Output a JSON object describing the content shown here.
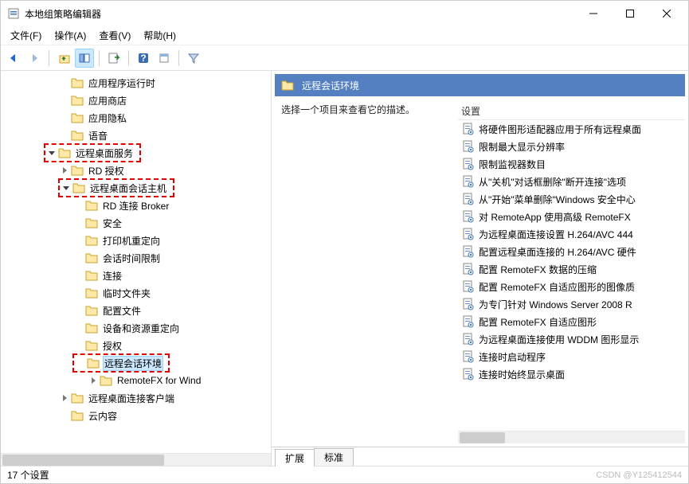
{
  "window": {
    "title": "本地组策略编辑器"
  },
  "menu": {
    "file": "文件(F)",
    "action": "操作(A)",
    "view": "查看(V)",
    "help": "帮助(H)"
  },
  "tree": {
    "items": [
      {
        "indent": 4,
        "exp": "none",
        "label": "应用程序运行时"
      },
      {
        "indent": 4,
        "exp": "none",
        "label": "应用商店"
      },
      {
        "indent": 4,
        "exp": "none",
        "label": "应用隐私"
      },
      {
        "indent": 4,
        "exp": "none",
        "label": "语音"
      },
      {
        "indent": 3,
        "exp": "open",
        "label": "远程桌面服务",
        "hl": true
      },
      {
        "indent": 4,
        "exp": "closed",
        "label": "RD 授权"
      },
      {
        "indent": 4,
        "exp": "open",
        "label": "远程桌面会话主机",
        "hl": true
      },
      {
        "indent": 5,
        "exp": "none",
        "label": "RD 连接 Broker"
      },
      {
        "indent": 5,
        "exp": "none",
        "label": "安全"
      },
      {
        "indent": 5,
        "exp": "none",
        "label": "打印机重定向"
      },
      {
        "indent": 5,
        "exp": "none",
        "label": "会话时间限制"
      },
      {
        "indent": 5,
        "exp": "none",
        "label": "连接"
      },
      {
        "indent": 5,
        "exp": "none",
        "label": "临时文件夹"
      },
      {
        "indent": 5,
        "exp": "none",
        "label": "配置文件"
      },
      {
        "indent": 5,
        "exp": "none",
        "label": "设备和资源重定向"
      },
      {
        "indent": 5,
        "exp": "none",
        "label": "授权"
      },
      {
        "indent": 5,
        "exp": "none",
        "label": "远程会话环境",
        "hl": true,
        "selected": true
      },
      {
        "indent": 6,
        "exp": "closed",
        "label": "RemoteFX for Wind"
      },
      {
        "indent": 4,
        "exp": "closed",
        "label": "远程桌面连接客户端"
      },
      {
        "indent": 4,
        "exp": "none",
        "label": "云内容"
      }
    ]
  },
  "right": {
    "header": "远程会话环境",
    "description": "选择一个项目来查看它的描述。",
    "settings_header": "设置",
    "settings": [
      "将硬件图形适配器应用于所有远程桌面",
      "限制最大显示分辨率",
      "限制监视器数目",
      "从\"关机\"对话框删除\"断开连接\"选项",
      "从\"开始\"菜单删除\"Windows 安全中心",
      "对 RemoteApp 使用高级 RemoteFX",
      "为远程桌面连接设置 H.264/AVC 444",
      "配置远程桌面连接的 H.264/AVC 硬件",
      "配置 RemoteFX 数据的压缩",
      "配置 RemoteFX 自适应图形的图像质",
      "为专门针对 Windows Server 2008 R",
      "配置 RemoteFX 自适应图形",
      "为远程桌面连接使用 WDDM 图形显示",
      "连接时启动程序",
      "连接时始终显示桌面"
    ]
  },
  "tabs": {
    "extended": "扩展",
    "standard": "标准"
  },
  "status": "17 个设置",
  "watermark": "CSDN @Y125412544"
}
